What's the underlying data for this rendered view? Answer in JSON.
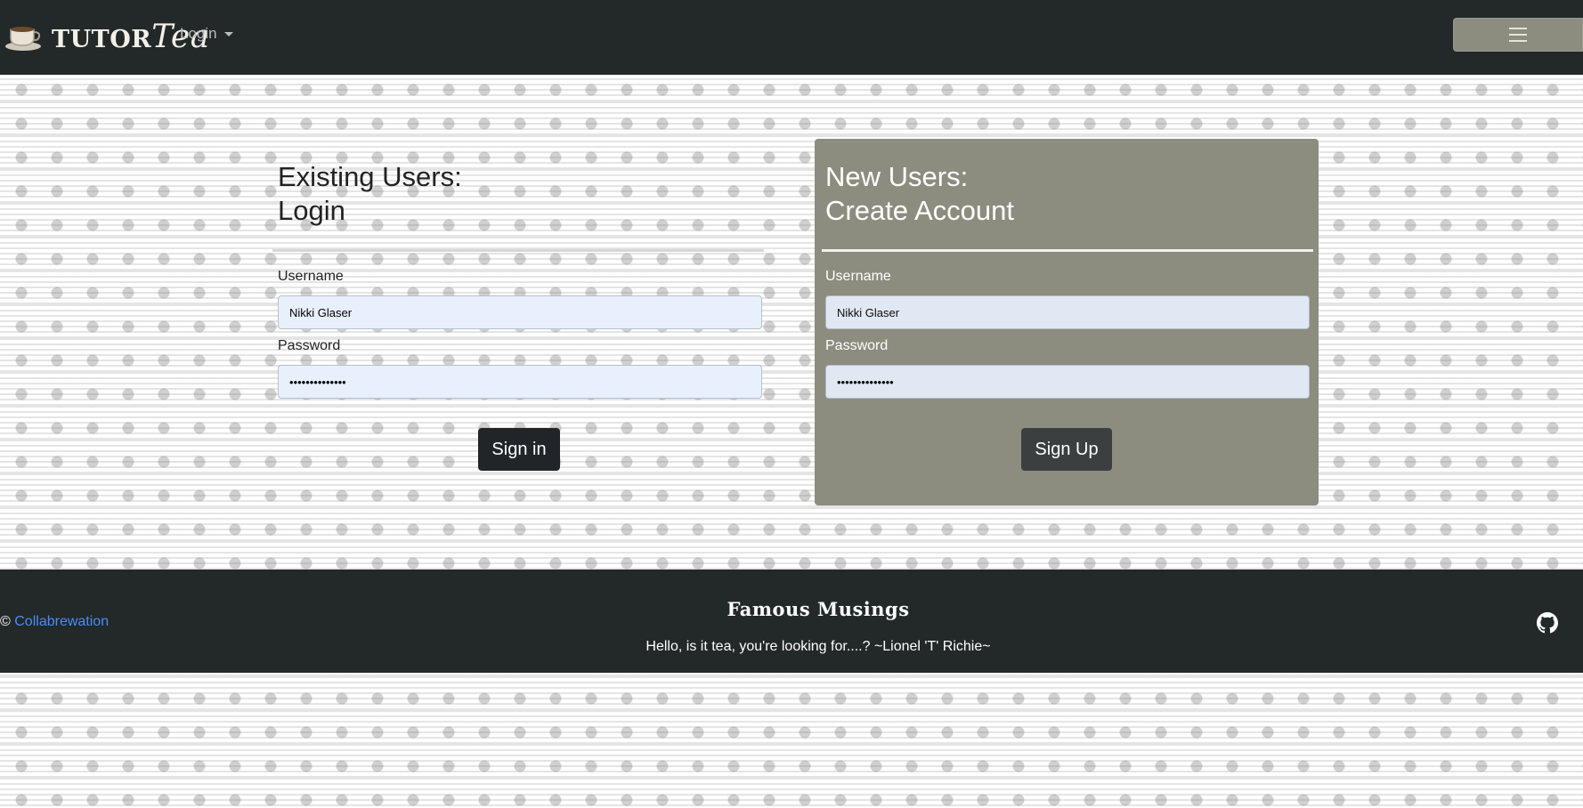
{
  "navbar": {
    "brand_main": "TUTOR",
    "brand_script": "Tea",
    "login_menu": "Login",
    "toggler_icon": "hamburger-icon"
  },
  "existing": {
    "title_line1": "Existing Users:",
    "title_line2": "Login",
    "username_label": "Username",
    "username_value": "Nikki Glaser",
    "password_label": "Password",
    "password_value": "••••••••••••••",
    "submit": "Sign in"
  },
  "newuser": {
    "title_line1": "New Users:",
    "title_line2": "Create Account",
    "username_label": "Username",
    "username_value": "Nikki Glaser",
    "password_label": "Password",
    "password_value": "••••••••••••••",
    "submit": "Sign Up"
  },
  "footer": {
    "copyright_symbol": "©",
    "copyright_link": "Collabrewation",
    "musings_title": "Famous Musings",
    "quote": "Hello, is it tea, you're looking for....? ~Lionel 'T' Richie~",
    "github_icon": "github-icon"
  },
  "colors": {
    "navbar_bg": "#232829",
    "panel_right_bg": "#8c8d7f",
    "link": "#4a8cf7"
  }
}
